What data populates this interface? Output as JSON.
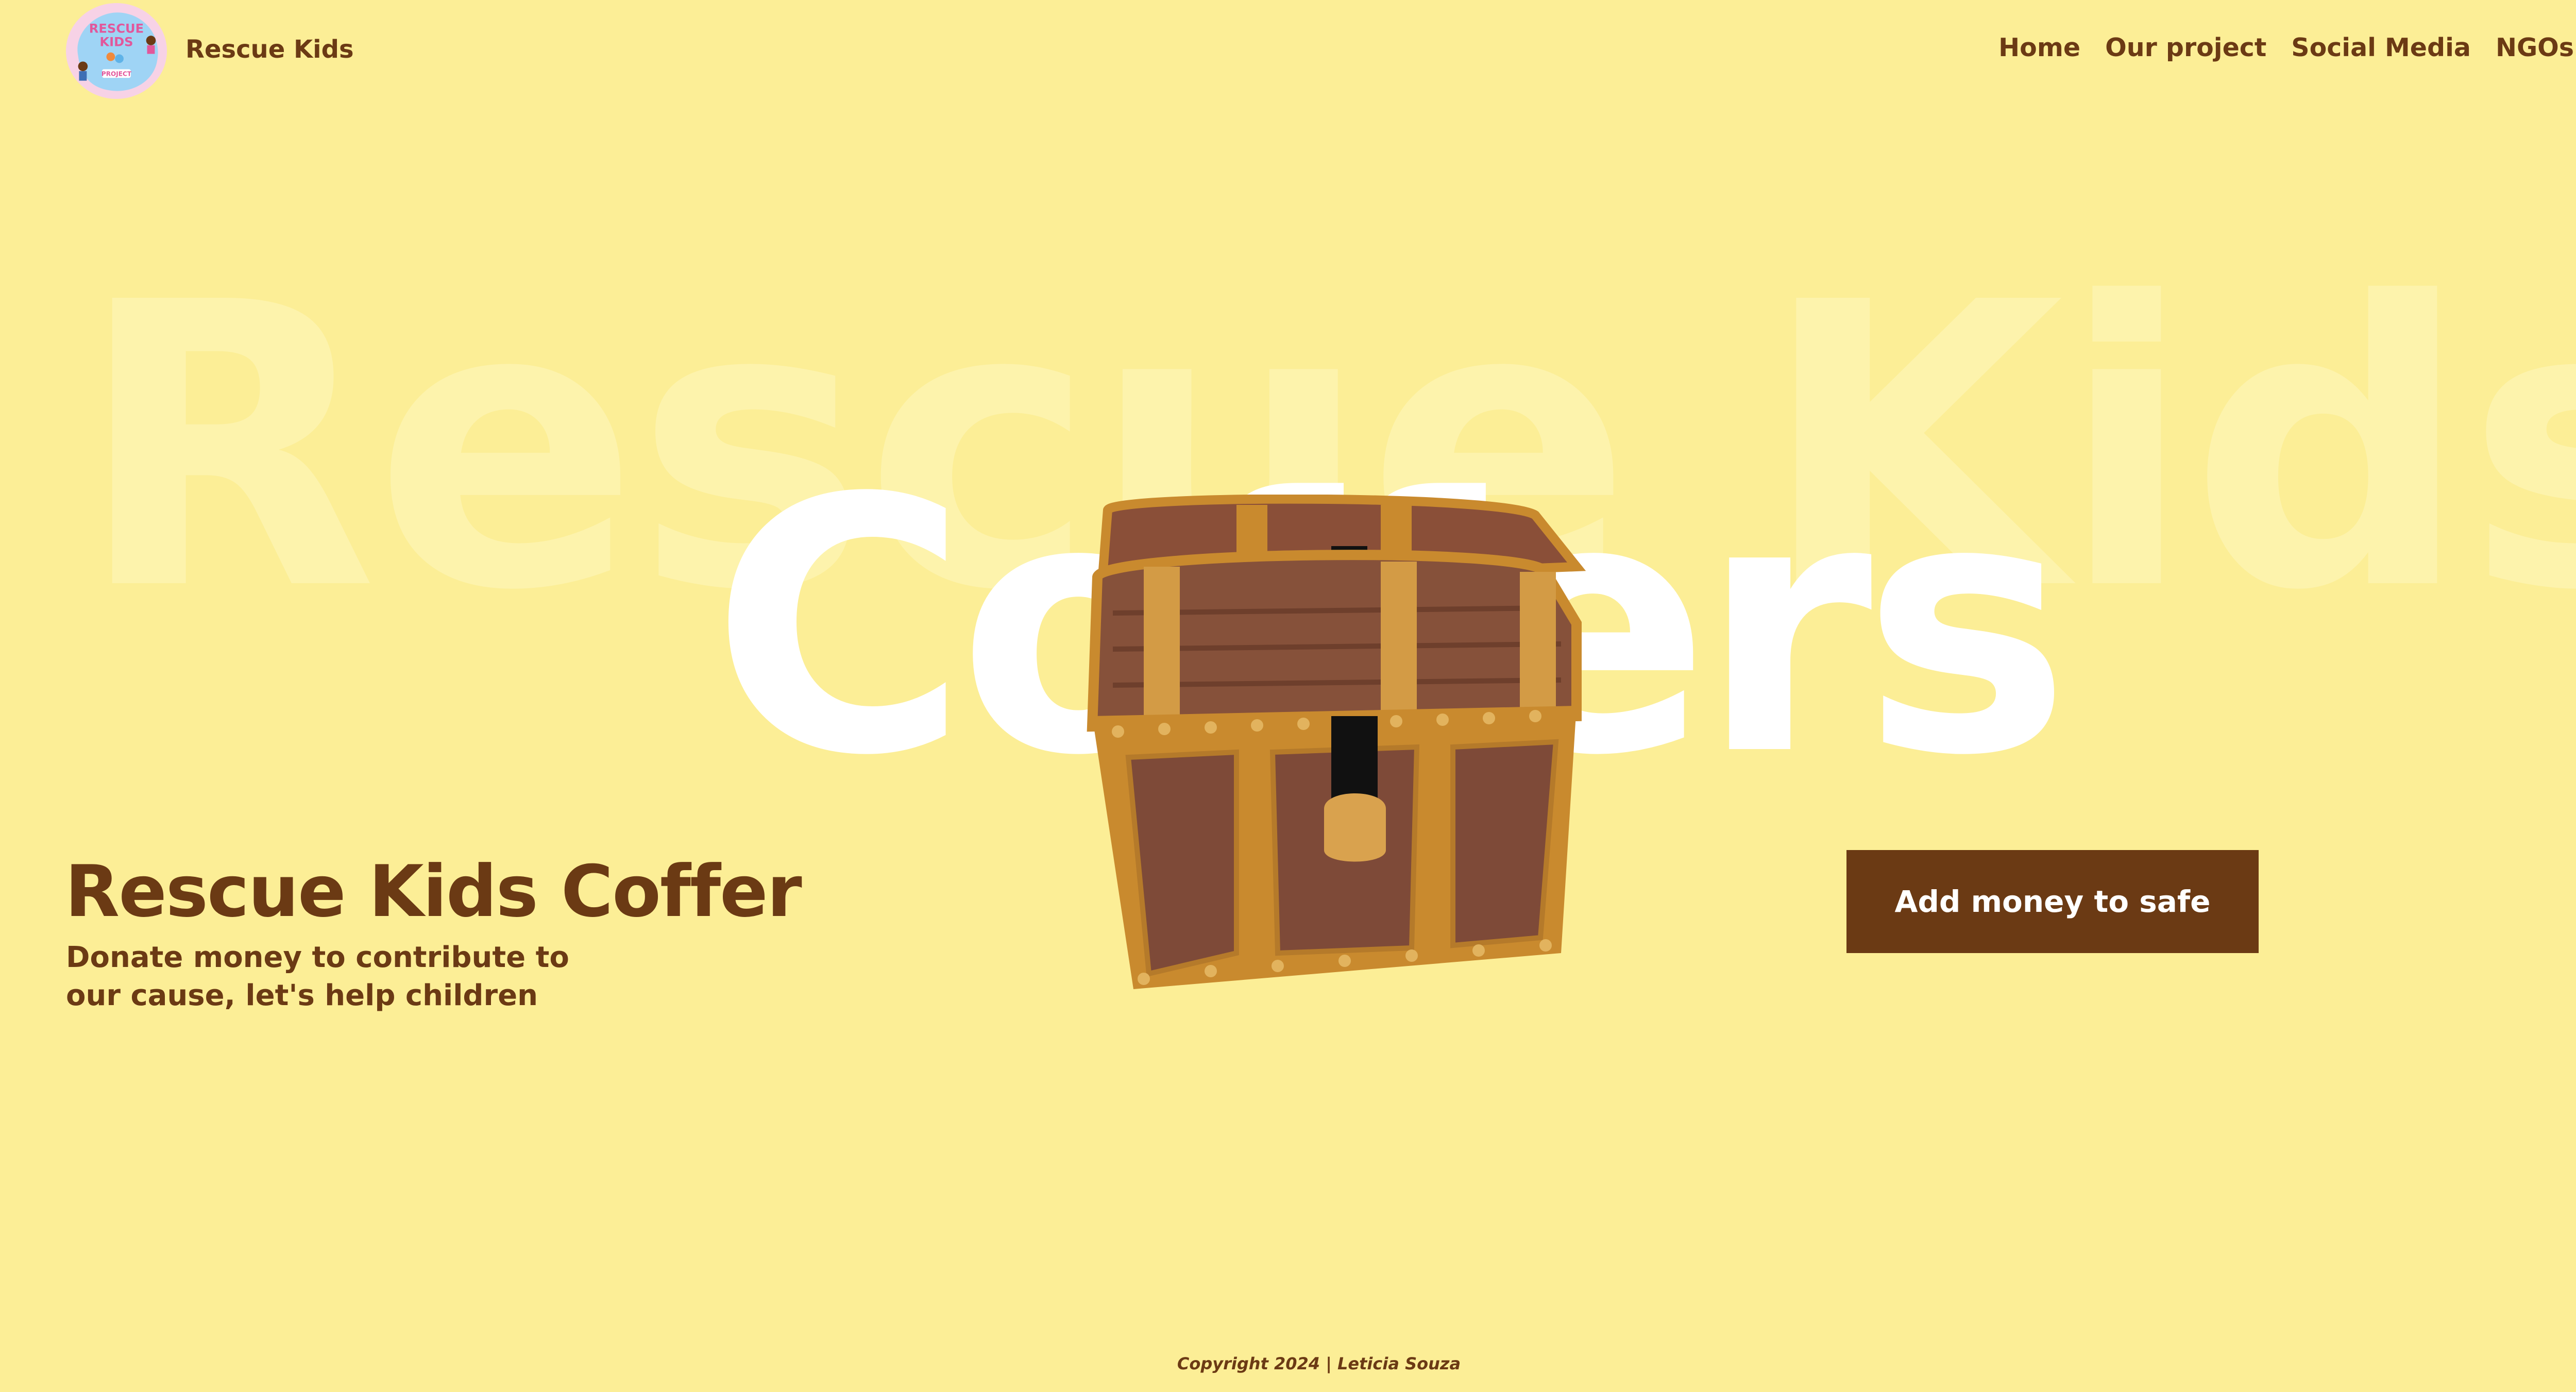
{
  "header": {
    "logo_text": "RESCUE KIDS PROJECT",
    "brand": "Rescue Kids",
    "nav": [
      {
        "label": "Home"
      },
      {
        "label": "Our project"
      },
      {
        "label": "Social Media"
      },
      {
        "label": "NGOs"
      }
    ]
  },
  "hero": {
    "background_title": "Rescue Kids",
    "overlay_title": "Coffers",
    "heading": "Rescue Kids Coffer",
    "subtitle": "Donate money to contribute to our cause, let's help children",
    "cta_label": "Add money to safe"
  },
  "footer": {
    "copyright": "Copyright 2024 | Leticia Souza"
  },
  "colors": {
    "background": "#fcee96",
    "brown": "#6b3a14",
    "white": "#ffffff"
  }
}
